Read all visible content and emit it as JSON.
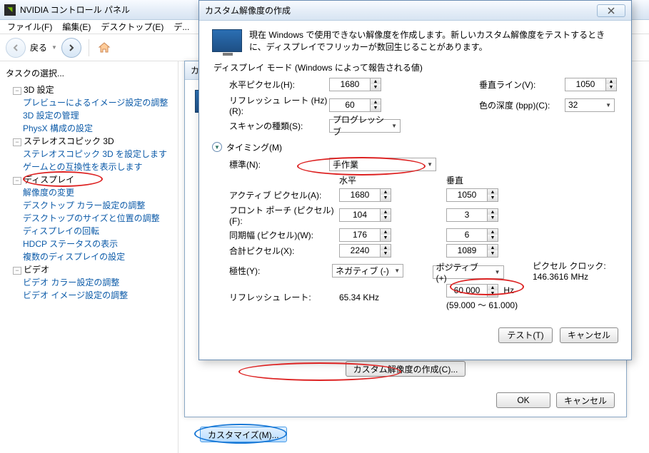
{
  "app": {
    "title": "NVIDIA コントロール パネル"
  },
  "menu": {
    "file": "ファイル(F)",
    "edit": "編集(E)",
    "desktop": "デスクトップ(E)",
    "display": "デ..."
  },
  "nav": {
    "back": "戻る"
  },
  "sidebar": {
    "header": "タスクの選択...",
    "g3d": {
      "label": "3D 設定",
      "preview": "プレビューによるイメージ設定の調整",
      "manage": "3D 設定の管理",
      "physx": "PhysX 構成の設定"
    },
    "stereo": {
      "label": "ステレオスコピック 3D",
      "set": "ステレオスコピック 3D を設定します",
      "compat": "ゲームとの互換性を表示します"
    },
    "display": {
      "label": "ディスプレイ",
      "res": "解像度の変更",
      "color": "デスクトップ カラー設定の調整",
      "size": "デスクトップのサイズと位置の調整",
      "rotate": "ディスプレイの回転",
      "hdcp": "HDCP ステータスの表示",
      "multi": "複数のディスプレイの設定"
    },
    "video": {
      "label": "ビデオ",
      "vcolor": "ビデオ カラー設定の調整",
      "vimage": "ビデオ イメージ設定の調整"
    }
  },
  "behind": {
    "title": "カスタマ",
    "create_btn": "カスタム解像度の作成(C)...",
    "ok": "OK",
    "cancel": "キャンセル"
  },
  "customize_btn": "カスタマイズ(M)...",
  "dialog": {
    "title": "カスタム解像度の作成",
    "intro": "現在 Windows で使用できない解像度を作成します。新しいカスタム解像度をテストするときに、ディスプレイでフリッカーが数回生じることがあります。",
    "mode_label": "ディスプレイ モード (Windows によって報告される値)",
    "hpixel_l": "水平ピクセル(H):",
    "hpixel_v": "1680",
    "vline_l": "垂直ライン(V):",
    "vline_v": "1050",
    "refresh_l": "リフレッシュ レート (Hz)(R):",
    "refresh_v": "60",
    "bpp_l": "色の深度 (bpp)(C):",
    "bpp_v": "32",
    "scan_l": "スキャンの種類(S):",
    "scan_v": "プログレッシブ",
    "timing_l": "タイミング(M)",
    "std_l": "標準(N):",
    "std_v": "手作業",
    "h_head": "水平",
    "v_head": "垂直",
    "active_l": "アクティブ ピクセル(A):",
    "active_h": "1680",
    "active_v": "1050",
    "fporch_l": "フロント ポーチ (ピクセル)(F):",
    "fporch_h": "104",
    "fporch_v": "3",
    "sync_l": "同期幅 (ピクセル)(W):",
    "sync_h": "176",
    "sync_v": "6",
    "total_l": "合計ピクセル(X):",
    "total_h": "2240",
    "total_v": "1089",
    "pol_l": "極性(Y):",
    "pol_h": "ネガティブ (-)",
    "pol_v": "ポジティブ (+)",
    "rrate_l": "リフレッシュ レート:",
    "rrate_k": "65.34 KHz",
    "rrate_hz_v": "60.000",
    "rrate_hz_u": "Hz",
    "rrate_range": "(59.000 ～ 61.000)",
    "pclock_l": "ピクセル クロック:",
    "pclock_v": "146.3616 MHz",
    "test": "テスト(T)",
    "cancel": "キャンセル"
  }
}
